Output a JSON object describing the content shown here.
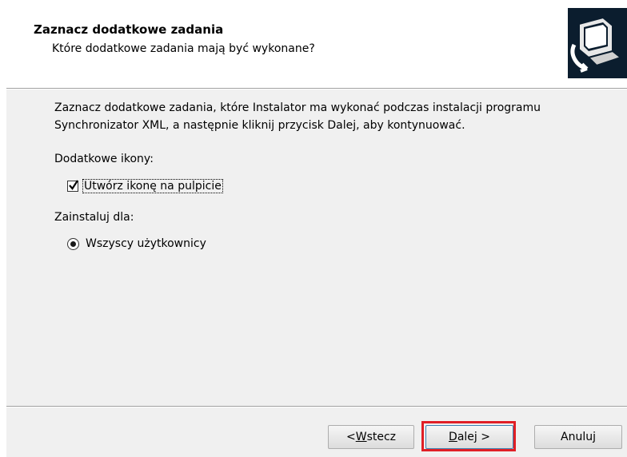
{
  "header": {
    "title": "Zaznacz dodatkowe zadania",
    "subtitle": "Które dodatkowe zadania mają być wykonane?",
    "logo_icon": "installer-computer-icon"
  },
  "content": {
    "description_line1": "Zaznacz dodatkowe zadania, które Instalator ma wykonać podczas instalacji programu",
    "description_line2": "Synchronizator XML, a następnie kliknij przycisk Dalej, aby kontynuować.",
    "icons_section_label": "Dodatkowe ikony:",
    "desktop_icon_checkbox": {
      "label": "Utwórz ikonę na pulpicie",
      "checked": true
    },
    "install_for_label": "Zainstaluj dla:",
    "all_users_radio": {
      "label": "Wszyscy użytkownicy",
      "selected": true
    }
  },
  "buttons": {
    "back_prefix": "< ",
    "back_accel": "W",
    "back_rest": "stecz",
    "next_accel": "D",
    "next_rest": "alej >",
    "cancel": "Anuluj"
  },
  "colors": {
    "highlight": "#e01f26",
    "dialog_bg": "#f0f0f0",
    "header_bg": "#ffffff"
  }
}
